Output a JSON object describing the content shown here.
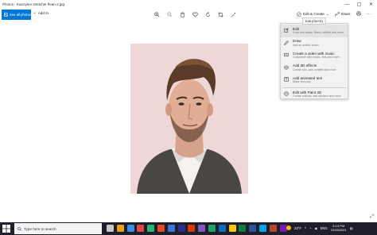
{
  "window": {
    "title": "Photos - Kanoyteo stretcher flean-2.jpg",
    "minimize_glyph": "—",
    "maximize_glyph": "▢",
    "close_glyph": "✕"
  },
  "toolbar": {
    "see_all_photos": "See all photos",
    "add_to": "Add to",
    "edit_create": "Edit & Create",
    "share": "Share",
    "icons": [
      "zoom-in-icon",
      "zoom-out-icon",
      "delete-icon",
      "favorite-icon",
      "rotate-icon",
      "crop-icon",
      "enhance-icon"
    ],
    "accent": "#0078d4"
  },
  "tooltip": {
    "text": "Edit (Ctrl+E)"
  },
  "menu": {
    "items": [
      {
        "icon": "edit-icon",
        "label": "Edit",
        "description": "Crop and rotate, filters, effects and more"
      },
      {
        "icon": "draw-icon",
        "label": "Draw",
        "description": "Add an artistic touch"
      },
      {
        "icon": "video-icon",
        "label": "Create a video with music",
        "description": "Customize with music, text and more"
      },
      {
        "icon": "3d-effects-icon",
        "label": "Add 3D effects",
        "description": "Create rain, add confetti and more"
      },
      {
        "icon": "animated-text-icon",
        "label": "Add animated text",
        "description": "Make text pop"
      },
      {
        "icon": "paint3d-icon",
        "label": "Edit with Paint 3D",
        "description": "Create cutouts, add stickers and more"
      }
    ]
  },
  "photo": {
    "background": "#efd7d8"
  },
  "taskbar": {
    "search_placeholder": "Type here to search",
    "weather": "23°F",
    "language": "ENG",
    "time": "5:13 PM",
    "date": "12/26/2021",
    "app_colors": [
      "#c9c9c9",
      "#e8a21a",
      "#3a8ee6",
      "#e04848",
      "#2bb673",
      "#e34c26",
      "#3c77d6",
      "#2d2d90",
      "#d83b01",
      "#7e57c2",
      "#1fa463",
      "#0f6cbd",
      "#f2c811",
      "#107c41",
      "#2b579a",
      "#00a4ef",
      "#b7472a",
      "#7719aa"
    ]
  }
}
